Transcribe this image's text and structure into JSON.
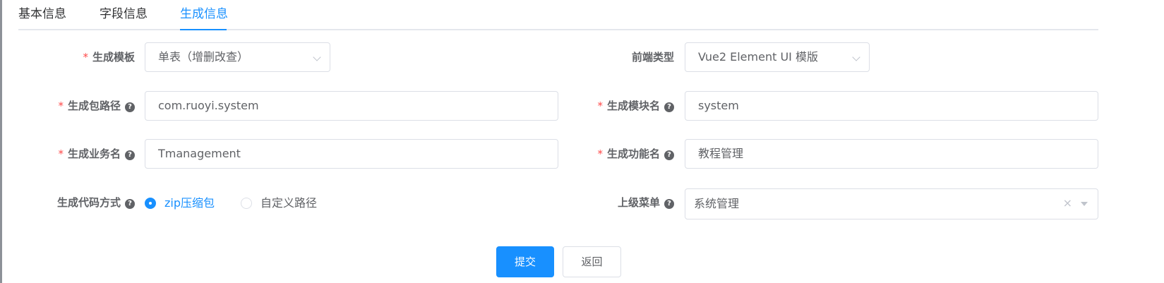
{
  "tabs": [
    {
      "label": "基本信息"
    },
    {
      "label": "字段信息"
    },
    {
      "label": "生成信息",
      "active": true
    }
  ],
  "form": {
    "template": {
      "label": "生成模板",
      "value": "单表（增删改查）"
    },
    "frontend_type": {
      "label": "前端类型",
      "value": "Vue2 Element UI 模版"
    },
    "package_path": {
      "label": "生成包路径",
      "value": "com.ruoyi.system"
    },
    "module_name": {
      "label": "生成模块名",
      "value": "system"
    },
    "business_name": {
      "label": "生成业务名",
      "value": "Tmanagement"
    },
    "function_name": {
      "label": "生成功能名",
      "value": "教程管理"
    },
    "gen_type": {
      "label": "生成代码方式",
      "options": [
        {
          "label": "zip压缩包",
          "checked": true
        },
        {
          "label": "自定义路径",
          "checked": false
        }
      ]
    },
    "parent_menu": {
      "label": "上级菜单",
      "value": "系统管理"
    }
  },
  "required_mark": "*",
  "help_glyph": "?",
  "clear_glyph": "×",
  "buttons": {
    "submit": "提交",
    "back": "返回"
  },
  "colors": {
    "primary": "#1890ff",
    "required": "#ff4949",
    "text": "#606266"
  }
}
